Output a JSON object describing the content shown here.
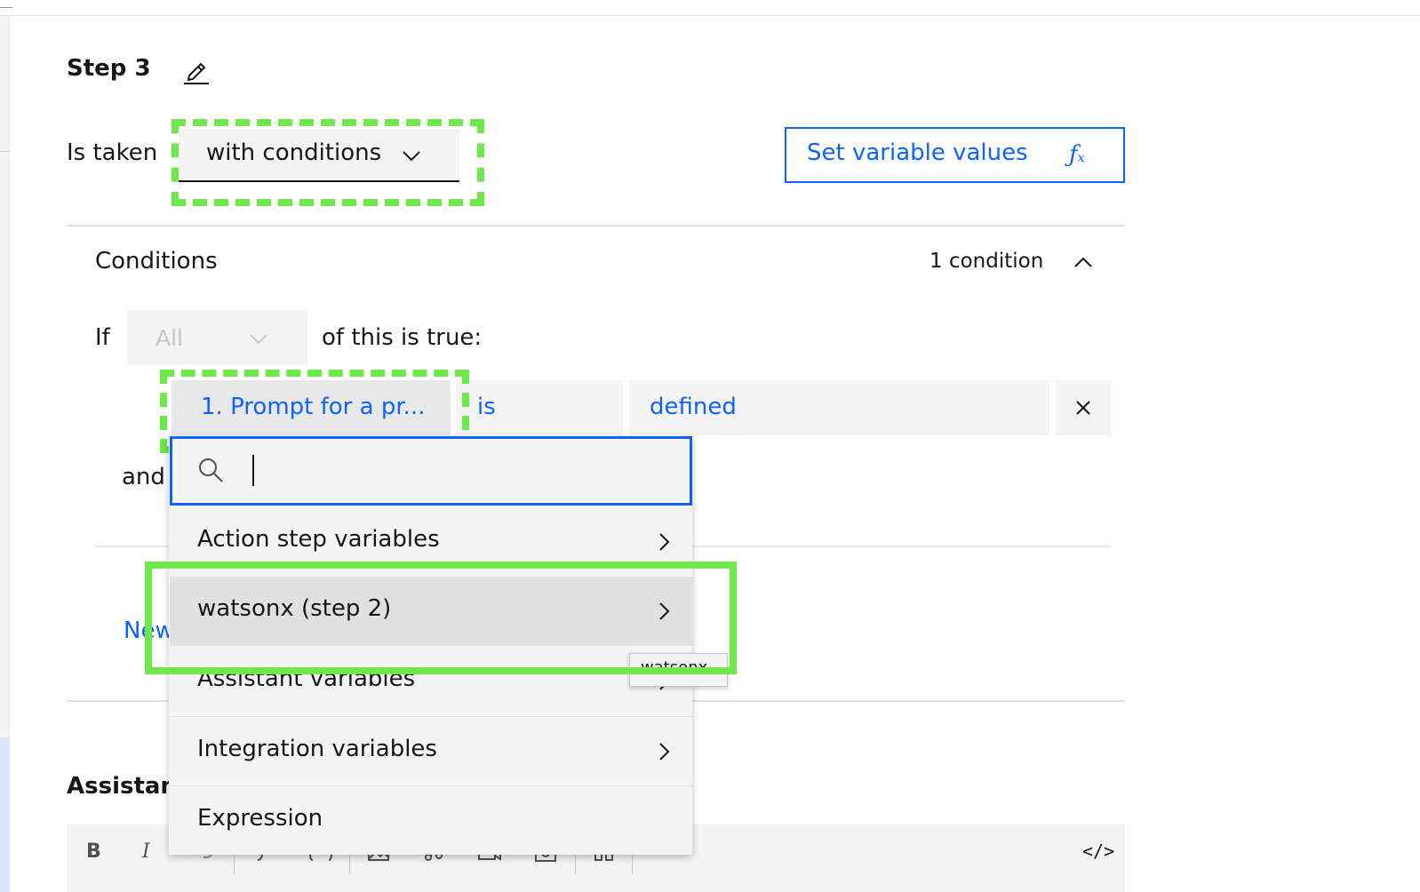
{
  "step": {
    "title": "Step 3",
    "is_taken_label": "Is taken",
    "is_taken_value": "with conditions",
    "set_variable_button": "Set variable values",
    "fx_main": "ƒ",
    "fx_sub": "x"
  },
  "conditions": {
    "title": "Conditions",
    "count_text": "1 condition",
    "if_label": "If",
    "match_value": "All",
    "of_this_label": "of this is true:",
    "row": {
      "left": "1. Prompt for a pr...",
      "operator": "is",
      "value": "defined"
    },
    "and_label": "and",
    "new_label": "New"
  },
  "assistant_label": "Assistant",
  "search": {
    "value": ""
  },
  "menu": {
    "items": [
      {
        "label": "Action step variables"
      },
      {
        "label": "watsonx (step 2)"
      },
      {
        "label": "Assistant variables"
      },
      {
        "label": "Integration variables"
      },
      {
        "label": "Expression"
      }
    ],
    "active_index": 1
  },
  "tooltip": {
    "text": "watsonx"
  },
  "toolbar": {
    "bold": "B",
    "italic": "I",
    "code": "</>"
  },
  "colors": {
    "accent": "#0f62fe",
    "annotation_green": "#6ee84a",
    "field_bg": "#f4f4f4",
    "text": "#161616"
  }
}
